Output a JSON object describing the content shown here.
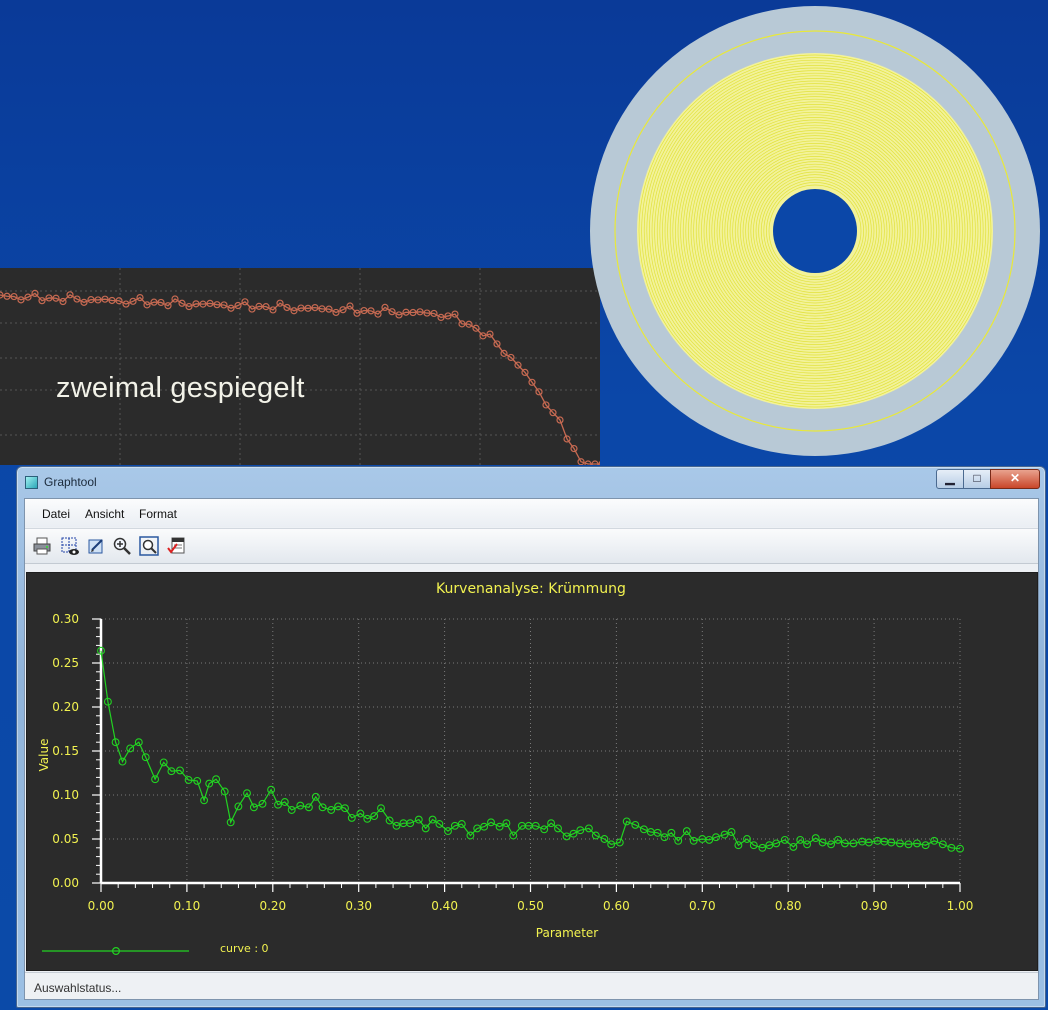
{
  "background": {
    "label": "zweimal gespiegelt",
    "fragment_color": "#c76a52"
  },
  "window": {
    "title": "Graphtool",
    "controls": {
      "minimize": "▁",
      "maximize": "□",
      "close": "✕"
    }
  },
  "menu": {
    "items": [
      "Datei",
      "Ansicht",
      "Format"
    ]
  },
  "toolbar": {
    "icons": [
      "print-icon",
      "grid-view-icon",
      "edit-icon",
      "zoom-in-icon",
      "zoom-fit-icon",
      "export-icon"
    ]
  },
  "status": {
    "text": "Auswahlstatus..."
  },
  "chart_data": {
    "type": "line",
    "title": "Kurvenanalyse: Krümmung",
    "xlabel": "Parameter",
    "ylabel": "Value",
    "xlim": [
      0,
      1
    ],
    "ylim": [
      0,
      0.3
    ],
    "xticks": [
      "0.00",
      "0.10",
      "0.20",
      "0.30",
      "0.40",
      "0.50",
      "0.60",
      "0.70",
      "0.80",
      "0.90",
      "1.00"
    ],
    "yticks": [
      "0.00",
      "0.05",
      "0.10",
      "0.15",
      "0.20",
      "0.25",
      "0.30"
    ],
    "grid": true,
    "legend_position": "bottom-left",
    "colors": {
      "line": "#22d322",
      "text": "#f2f250",
      "background": "#2b2b2b"
    },
    "series": [
      {
        "name": "curve : 0",
        "x": [
          0.0,
          0.008,
          0.017,
          0.025,
          0.034,
          0.044,
          0.052,
          0.063,
          0.073,
          0.082,
          0.092,
          0.102,
          0.112,
          0.12,
          0.126,
          0.134,
          0.144,
          0.151,
          0.16,
          0.17,
          0.178,
          0.188,
          0.198,
          0.206,
          0.214,
          0.222,
          0.232,
          0.242,
          0.25,
          0.258,
          0.268,
          0.276,
          0.284,
          0.292,
          0.302,
          0.31,
          0.318,
          0.326,
          0.336,
          0.344,
          0.352,
          0.36,
          0.37,
          0.378,
          0.386,
          0.394,
          0.404,
          0.412,
          0.42,
          0.43,
          0.438,
          0.446,
          0.454,
          0.464,
          0.472,
          0.48,
          0.49,
          0.498,
          0.506,
          0.516,
          0.524,
          0.532,
          0.542,
          0.55,
          0.558,
          0.568,
          0.576,
          0.586,
          0.594,
          0.604,
          0.612,
          0.622,
          0.632,
          0.64,
          0.648,
          0.656,
          0.664,
          0.672,
          0.682,
          0.69,
          0.7,
          0.708,
          0.716,
          0.726,
          0.734,
          0.742,
          0.752,
          0.76,
          0.77,
          0.778,
          0.786,
          0.796,
          0.806,
          0.814,
          0.822,
          0.832,
          0.84,
          0.85,
          0.858,
          0.866,
          0.876,
          0.886,
          0.894,
          0.904,
          0.912,
          0.92,
          0.93,
          0.94,
          0.95,
          0.96,
          0.97,
          0.98,
          0.99,
          1.0
        ],
        "y": [
          0.264,
          0.206,
          0.16,
          0.138,
          0.153,
          0.16,
          0.143,
          0.118,
          0.137,
          0.127,
          0.128,
          0.117,
          0.116,
          0.094,
          0.113,
          0.118,
          0.104,
          0.069,
          0.087,
          0.102,
          0.086,
          0.09,
          0.106,
          0.089,
          0.092,
          0.083,
          0.088,
          0.086,
          0.098,
          0.086,
          0.083,
          0.087,
          0.085,
          0.074,
          0.079,
          0.073,
          0.076,
          0.085,
          0.071,
          0.065,
          0.068,
          0.068,
          0.072,
          0.062,
          0.072,
          0.067,
          0.059,
          0.065,
          0.067,
          0.054,
          0.062,
          0.064,
          0.069,
          0.064,
          0.068,
          0.054,
          0.065,
          0.065,
          0.065,
          0.061,
          0.068,
          0.062,
          0.053,
          0.056,
          0.06,
          0.062,
          0.054,
          0.05,
          0.044,
          0.046,
          0.07,
          0.066,
          0.061,
          0.058,
          0.057,
          0.052,
          0.057,
          0.048,
          0.059,
          0.048,
          0.05,
          0.049,
          0.052,
          0.055,
          0.058,
          0.043,
          0.05,
          0.043,
          0.04,
          0.043,
          0.045,
          0.049,
          0.041,
          0.049,
          0.044,
          0.051,
          0.046,
          0.044,
          0.049,
          0.045,
          0.045,
          0.047,
          0.046,
          0.048,
          0.047,
          0.046,
          0.045,
          0.044,
          0.045,
          0.043,
          0.048,
          0.044,
          0.04,
          0.039
        ]
      }
    ]
  }
}
